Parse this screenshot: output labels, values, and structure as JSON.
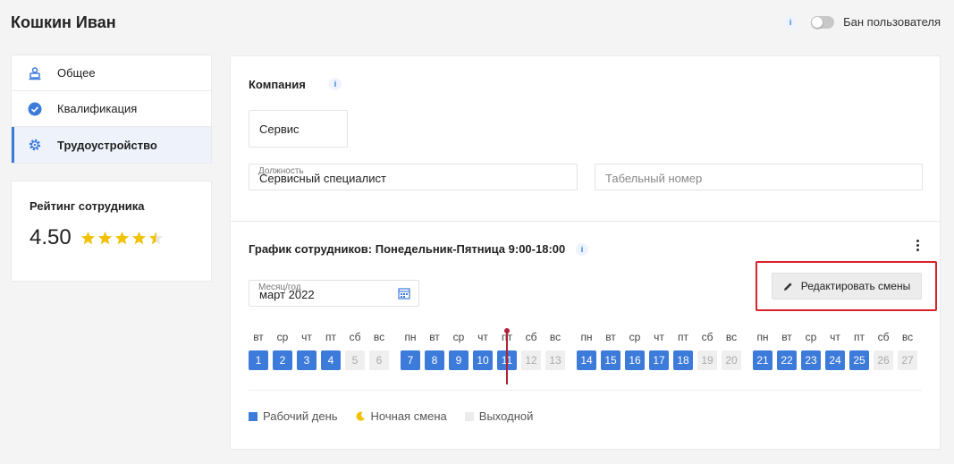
{
  "header": {
    "title": "Кошкин Иван",
    "ban_label": "Бан пользователя",
    "info_icon": "info-icon"
  },
  "sidebar": {
    "items": [
      {
        "label": "Общее",
        "icon": "user-badge-icon"
      },
      {
        "label": "Квалификация",
        "icon": "check-circle-icon"
      },
      {
        "label": "Трудоустройство",
        "icon": "gear-icon",
        "active": true
      }
    ]
  },
  "rating": {
    "title": "Рейтинг сотрудника",
    "value": "4.50",
    "stars": 4.5
  },
  "company": {
    "title": "Компания",
    "company_value": "Сервис",
    "position_label": "Должность",
    "position_value": "Сервисный специалист",
    "tab_number_placeholder": "Табельный номер"
  },
  "schedule": {
    "title": "График сотрудников: Понедельник-Пятница 9:00-18:00",
    "month_label": "Месяц/год",
    "month_value": "март 2022",
    "edit_button_label": "Редактировать смены",
    "days": [
      {
        "name": "вт",
        "num": "1",
        "type": "work"
      },
      {
        "name": "ср",
        "num": "2",
        "type": "work"
      },
      {
        "name": "чт",
        "num": "3",
        "type": "work"
      },
      {
        "name": "пт",
        "num": "4",
        "type": "work"
      },
      {
        "name": "сб",
        "num": "5",
        "type": "off"
      },
      {
        "name": "вс",
        "num": "6",
        "type": "off"
      },
      {
        "name": "пн",
        "num": "7",
        "type": "work"
      },
      {
        "name": "вт",
        "num": "8",
        "type": "work"
      },
      {
        "name": "ср",
        "num": "9",
        "type": "work"
      },
      {
        "name": "чт",
        "num": "10",
        "type": "work"
      },
      {
        "name": "пт",
        "num": "11",
        "type": "work",
        "today": true
      },
      {
        "name": "сб",
        "num": "12",
        "type": "off"
      },
      {
        "name": "вс",
        "num": "13",
        "type": "off"
      },
      {
        "name": "пн",
        "num": "14",
        "type": "work"
      },
      {
        "name": "вт",
        "num": "15",
        "type": "work"
      },
      {
        "name": "ср",
        "num": "16",
        "type": "work"
      },
      {
        "name": "чт",
        "num": "17",
        "type": "work"
      },
      {
        "name": "пт",
        "num": "18",
        "type": "work"
      },
      {
        "name": "сб",
        "num": "19",
        "type": "off"
      },
      {
        "name": "вс",
        "num": "20",
        "type": "off"
      },
      {
        "name": "пн",
        "num": "21",
        "type": "work"
      },
      {
        "name": "вт",
        "num": "22",
        "type": "work"
      },
      {
        "name": "ср",
        "num": "23",
        "type": "work"
      },
      {
        "name": "чт",
        "num": "24",
        "type": "work"
      },
      {
        "name": "пт",
        "num": "25",
        "type": "work"
      },
      {
        "name": "сб",
        "num": "26",
        "type": "off"
      },
      {
        "name": "вс",
        "num": "27",
        "type": "off"
      }
    ]
  },
  "legend": {
    "work_label": "Рабочий день",
    "night_label": "Ночная смена",
    "off_label": "Выходной"
  },
  "colors": {
    "accent": "#3d7bda",
    "highlight": "#d9232a",
    "today": "#b0223a",
    "night": "#f2c200"
  }
}
